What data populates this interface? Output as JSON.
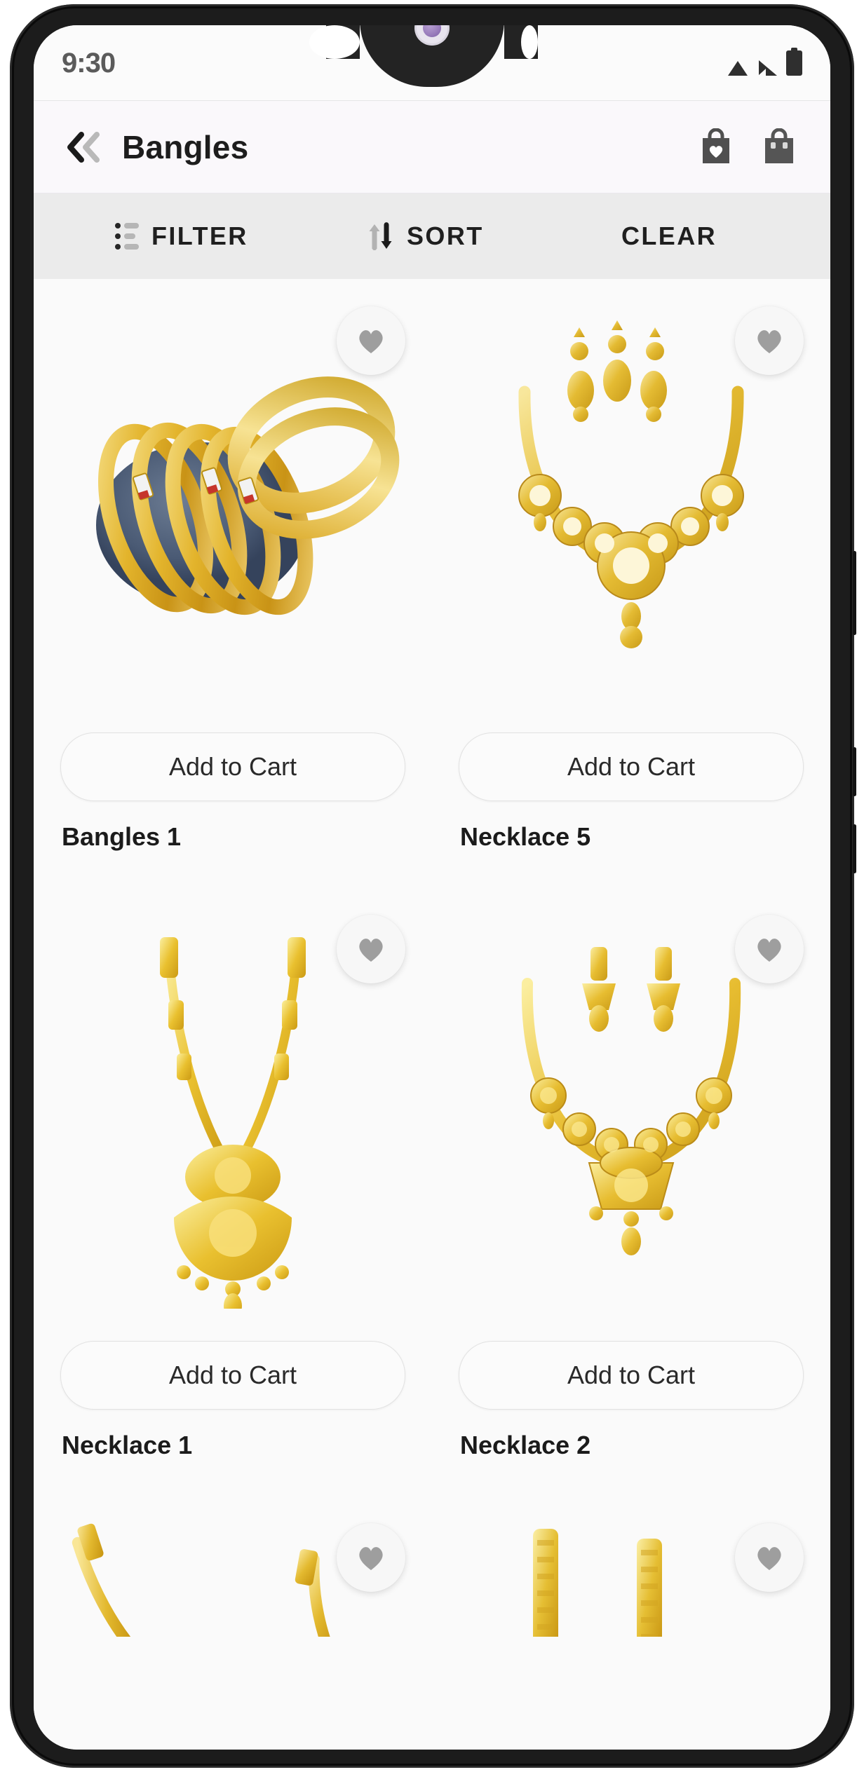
{
  "status_bar": {
    "time": "9:30",
    "icons": [
      "wifi-icon",
      "signal-icon",
      "battery-icon"
    ]
  },
  "app_bar": {
    "back_icon": "double-chevron-left-icon",
    "title": "Bangles",
    "wishlist_icon": "bag-heart-icon",
    "cart_icon": "shopping-bag-icon"
  },
  "filter_bar": {
    "filter": {
      "label": "FILTER",
      "icon": "filter-list-icon"
    },
    "sort": {
      "label": "SORT",
      "icon": "sort-arrows-icon"
    },
    "clear": {
      "label": "CLEAR",
      "icon": ""
    }
  },
  "products": [
    {
      "name": "Bangles 1",
      "cart_label": "Add to Cart",
      "fav_icon": "heart-icon",
      "image": "gold-bangles-set"
    },
    {
      "name": "Necklace 5",
      "cart_label": "Add to Cart",
      "fav_icon": "heart-icon",
      "image": "gold-necklace-earrings-set"
    },
    {
      "name": "Necklace 1",
      "cart_label": "Add to Cart",
      "fav_icon": "heart-icon",
      "image": "gold-long-haram-pendant"
    },
    {
      "name": "Necklace 2",
      "cart_label": "Add to Cart",
      "fav_icon": "heart-icon",
      "image": "gold-necklace-jhumka-set"
    },
    {
      "name": "",
      "cart_label": "",
      "fav_icon": "heart-icon",
      "image": "gold-bangles-pair-partial"
    },
    {
      "name": "",
      "cart_label": "",
      "fav_icon": "heart-icon",
      "image": "gold-bangles-pair-partial-2"
    }
  ],
  "colors": {
    "accent_gold": "#e0b325",
    "app_bar_bg": "#faf8fb",
    "filter_bar_bg": "#ebebeb",
    "page_bg": "#fafafa",
    "text_primary": "#1d1d1d",
    "heart_gray": "#9e9e9e"
  }
}
